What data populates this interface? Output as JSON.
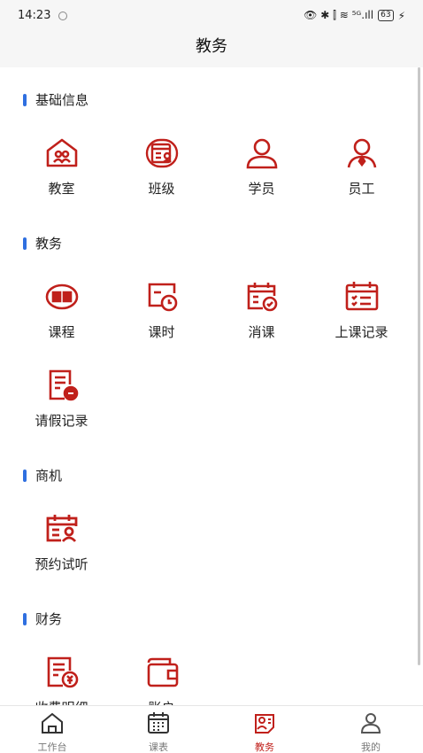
{
  "status": {
    "time": "14:23",
    "right_text": "👁 ✱ ⫿ ≋ ⁵ᴳ.ıll",
    "battery": "63"
  },
  "header": {
    "title": "教务"
  },
  "colors": {
    "accent": "#c0201b",
    "section_bar": "#2f6fe0"
  },
  "sections": [
    {
      "title": "基础信息",
      "items": [
        {
          "label": "教室",
          "icon": "classroom-icon"
        },
        {
          "label": "班级",
          "icon": "class-icon"
        },
        {
          "label": "学员",
          "icon": "student-icon"
        },
        {
          "label": "员工",
          "icon": "staff-icon"
        }
      ]
    },
    {
      "title": "教务",
      "items": [
        {
          "label": "课程",
          "icon": "course-book-icon"
        },
        {
          "label": "课时",
          "icon": "class-hour-icon"
        },
        {
          "label": "消课",
          "icon": "consume-class-icon"
        },
        {
          "label": "上课记录",
          "icon": "attendance-record-icon"
        },
        {
          "label": "请假记录",
          "icon": "leave-record-icon"
        }
      ]
    },
    {
      "title": "商机",
      "items": [
        {
          "label": "预约试听",
          "icon": "trial-booking-icon"
        }
      ]
    },
    {
      "title": "财务",
      "items": [
        {
          "label": "收费明细",
          "icon": "fee-details-icon"
        },
        {
          "label": "账户",
          "icon": "wallet-icon"
        }
      ]
    }
  ],
  "tabs": [
    {
      "label": "工作台",
      "icon": "home-icon",
      "active": false
    },
    {
      "label": "课表",
      "icon": "timetable-icon",
      "active": false
    },
    {
      "label": "教务",
      "icon": "academic-icon",
      "active": true
    },
    {
      "label": "我的",
      "icon": "profile-icon",
      "active": false
    }
  ]
}
